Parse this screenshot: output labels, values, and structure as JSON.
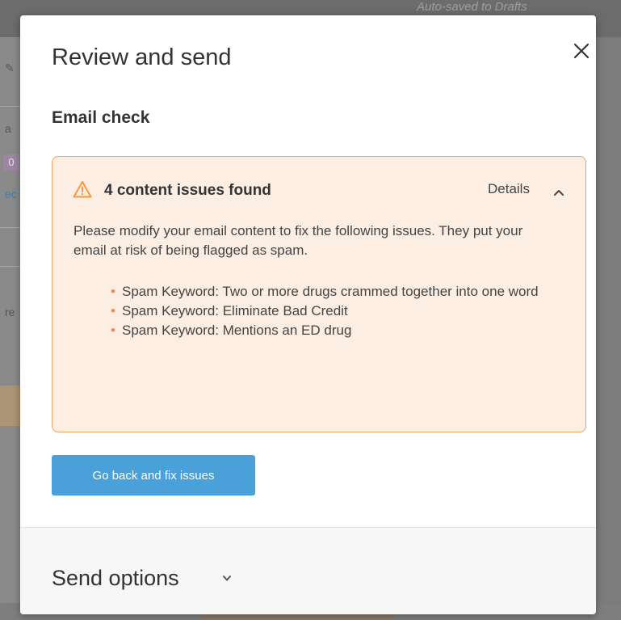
{
  "background": {
    "autosave_text": "Auto-saved to Drafts",
    "badge_text": "0"
  },
  "modal": {
    "title": "Review and send",
    "close_icon": "close-icon",
    "email_check": {
      "heading": "Email check",
      "alert": {
        "icon": "warning-icon",
        "title": "4 content issues found",
        "details_label": "Details",
        "details_icon": "chevron-up-icon",
        "description": "Please modify your email content to fix the following issues. They put your email at risk of being flagged as spam.",
        "issues": [
          "Spam Keyword: Two or more drugs crammed together into one word",
          "Spam Keyword: Eliminate Bad Credit",
          "Spam Keyword: Mentions an ED drug"
        ],
        "bullet": "•"
      },
      "fix_button_label": "Go back and fix issues"
    },
    "footer": {
      "send_options_label": "Send options",
      "send_options_icon": "chevron-down-icon"
    }
  },
  "colors": {
    "accent_button": "#4aa0d8",
    "alert_background": "#fdeee4",
    "alert_border": "#f0a16a",
    "warning_icon": "#f39a3c",
    "bullet": "#f08a4a"
  }
}
